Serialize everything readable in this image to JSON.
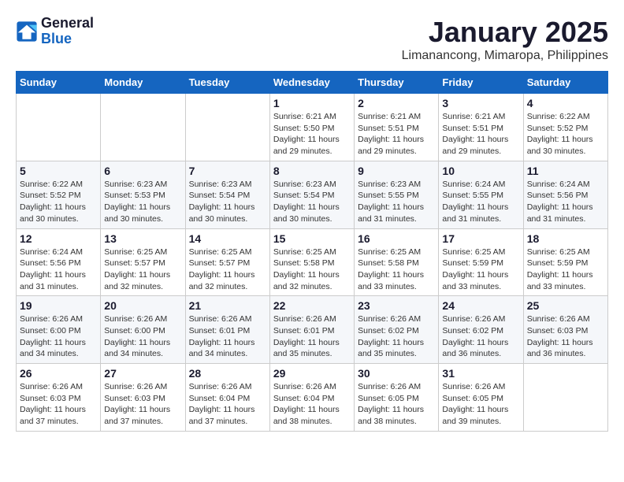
{
  "header": {
    "logo_line1": "General",
    "logo_line2": "Blue",
    "month": "January 2025",
    "location": "Limanancong, Mimaropa, Philippines"
  },
  "weekdays": [
    "Sunday",
    "Monday",
    "Tuesday",
    "Wednesday",
    "Thursday",
    "Friday",
    "Saturday"
  ],
  "weeks": [
    [
      {
        "day": "",
        "info": ""
      },
      {
        "day": "",
        "info": ""
      },
      {
        "day": "",
        "info": ""
      },
      {
        "day": "1",
        "info": "Sunrise: 6:21 AM\nSunset: 5:50 PM\nDaylight: 11 hours and 29 minutes."
      },
      {
        "day": "2",
        "info": "Sunrise: 6:21 AM\nSunset: 5:51 PM\nDaylight: 11 hours and 29 minutes."
      },
      {
        "day": "3",
        "info": "Sunrise: 6:21 AM\nSunset: 5:51 PM\nDaylight: 11 hours and 29 minutes."
      },
      {
        "day": "4",
        "info": "Sunrise: 6:22 AM\nSunset: 5:52 PM\nDaylight: 11 hours and 30 minutes."
      }
    ],
    [
      {
        "day": "5",
        "info": "Sunrise: 6:22 AM\nSunset: 5:52 PM\nDaylight: 11 hours and 30 minutes."
      },
      {
        "day": "6",
        "info": "Sunrise: 6:23 AM\nSunset: 5:53 PM\nDaylight: 11 hours and 30 minutes."
      },
      {
        "day": "7",
        "info": "Sunrise: 6:23 AM\nSunset: 5:54 PM\nDaylight: 11 hours and 30 minutes."
      },
      {
        "day": "8",
        "info": "Sunrise: 6:23 AM\nSunset: 5:54 PM\nDaylight: 11 hours and 30 minutes."
      },
      {
        "day": "9",
        "info": "Sunrise: 6:23 AM\nSunset: 5:55 PM\nDaylight: 11 hours and 31 minutes."
      },
      {
        "day": "10",
        "info": "Sunrise: 6:24 AM\nSunset: 5:55 PM\nDaylight: 11 hours and 31 minutes."
      },
      {
        "day": "11",
        "info": "Sunrise: 6:24 AM\nSunset: 5:56 PM\nDaylight: 11 hours and 31 minutes."
      }
    ],
    [
      {
        "day": "12",
        "info": "Sunrise: 6:24 AM\nSunset: 5:56 PM\nDaylight: 11 hours and 31 minutes."
      },
      {
        "day": "13",
        "info": "Sunrise: 6:25 AM\nSunset: 5:57 PM\nDaylight: 11 hours and 32 minutes."
      },
      {
        "day": "14",
        "info": "Sunrise: 6:25 AM\nSunset: 5:57 PM\nDaylight: 11 hours and 32 minutes."
      },
      {
        "day": "15",
        "info": "Sunrise: 6:25 AM\nSunset: 5:58 PM\nDaylight: 11 hours and 32 minutes."
      },
      {
        "day": "16",
        "info": "Sunrise: 6:25 AM\nSunset: 5:58 PM\nDaylight: 11 hours and 33 minutes."
      },
      {
        "day": "17",
        "info": "Sunrise: 6:25 AM\nSunset: 5:59 PM\nDaylight: 11 hours and 33 minutes."
      },
      {
        "day": "18",
        "info": "Sunrise: 6:25 AM\nSunset: 5:59 PM\nDaylight: 11 hours and 33 minutes."
      }
    ],
    [
      {
        "day": "19",
        "info": "Sunrise: 6:26 AM\nSunset: 6:00 PM\nDaylight: 11 hours and 34 minutes."
      },
      {
        "day": "20",
        "info": "Sunrise: 6:26 AM\nSunset: 6:00 PM\nDaylight: 11 hours and 34 minutes."
      },
      {
        "day": "21",
        "info": "Sunrise: 6:26 AM\nSunset: 6:01 PM\nDaylight: 11 hours and 34 minutes."
      },
      {
        "day": "22",
        "info": "Sunrise: 6:26 AM\nSunset: 6:01 PM\nDaylight: 11 hours and 35 minutes."
      },
      {
        "day": "23",
        "info": "Sunrise: 6:26 AM\nSunset: 6:02 PM\nDaylight: 11 hours and 35 minutes."
      },
      {
        "day": "24",
        "info": "Sunrise: 6:26 AM\nSunset: 6:02 PM\nDaylight: 11 hours and 36 minutes."
      },
      {
        "day": "25",
        "info": "Sunrise: 6:26 AM\nSunset: 6:03 PM\nDaylight: 11 hours and 36 minutes."
      }
    ],
    [
      {
        "day": "26",
        "info": "Sunrise: 6:26 AM\nSunset: 6:03 PM\nDaylight: 11 hours and 37 minutes."
      },
      {
        "day": "27",
        "info": "Sunrise: 6:26 AM\nSunset: 6:03 PM\nDaylight: 11 hours and 37 minutes."
      },
      {
        "day": "28",
        "info": "Sunrise: 6:26 AM\nSunset: 6:04 PM\nDaylight: 11 hours and 37 minutes."
      },
      {
        "day": "29",
        "info": "Sunrise: 6:26 AM\nSunset: 6:04 PM\nDaylight: 11 hours and 38 minutes."
      },
      {
        "day": "30",
        "info": "Sunrise: 6:26 AM\nSunset: 6:05 PM\nDaylight: 11 hours and 38 minutes."
      },
      {
        "day": "31",
        "info": "Sunrise: 6:26 AM\nSunset: 6:05 PM\nDaylight: 11 hours and 39 minutes."
      },
      {
        "day": "",
        "info": ""
      }
    ]
  ]
}
